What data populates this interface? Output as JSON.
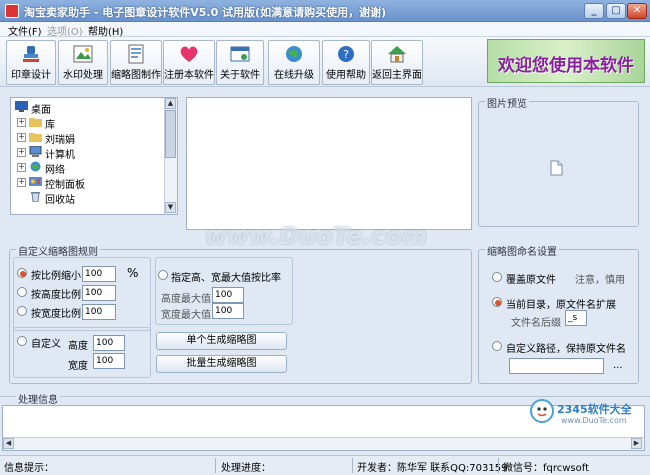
{
  "window": {
    "title": "淘宝卖家助手 - 电子图章设计软件V5.0 试用版(如满意请购买使用，谢谢)",
    "min_label": "_",
    "max_label": "□",
    "close_label": "✕"
  },
  "menu": {
    "file": "文件(F)",
    "options": "选项(O)",
    "help": "帮助(H)"
  },
  "toolbar": {
    "buttons": [
      {
        "label": "印章设计",
        "icon": "seal-icon"
      },
      {
        "label": "水印处理",
        "icon": "watermark-icon"
      },
      {
        "label": "缩略图制作",
        "icon": "thumbnail-icon"
      },
      {
        "label": "注册本软件",
        "icon": "register-heart-icon"
      },
      {
        "label": "关于软件",
        "icon": "about-icon"
      },
      {
        "label": "在线升级",
        "icon": "update-icon"
      },
      {
        "label": "使用帮助",
        "icon": "help-icon"
      },
      {
        "label": "返回主界面",
        "icon": "home-icon"
      }
    ],
    "banner_text": "欢迎您使用本软件"
  },
  "tree": {
    "items": [
      {
        "label": "桌面",
        "expander": ""
      },
      {
        "label": "库",
        "expander": "+"
      },
      {
        "label": "刘瑞娟",
        "expander": "+"
      },
      {
        "label": "计算机",
        "expander": "+"
      },
      {
        "label": "网络",
        "expander": "+"
      },
      {
        "label": "控制面板",
        "expander": "+"
      },
      {
        "label": "回收站",
        "expander": ""
      }
    ]
  },
  "preview": {
    "title": "图片预览"
  },
  "thumb_rules": {
    "title": "自定义缩略图规则",
    "by_ratio_label": "按比例缩小",
    "by_ratio_value": "100",
    "percent": "%",
    "by_height_label": "按高度比例",
    "by_height_value": "100",
    "by_width_label": "按宽度比例",
    "by_width_value": "100",
    "custom_label": "自定义",
    "custom_height_label": "高度",
    "custom_height_value": "100",
    "custom_width_label": "宽度",
    "custom_width_value": "100",
    "max_ratio_label": "指定高、宽最大值按比率",
    "max_height_label": "高度最大值",
    "max_height_value": "100",
    "max_width_label": "宽度最大值",
    "max_width_value": "100",
    "single_button": "单个生成缩略图",
    "batch_button": "批量生成缩略图"
  },
  "naming": {
    "title": "缩略图命名设置",
    "overwrite_label": "覆盖原文件",
    "note": "注意，慎用",
    "current_dir_label": "当前目录，原文件名扩展",
    "suffix_label": "文件名后缀",
    "suffix_value": "_s",
    "custom_path_label": "自定义路径，保持原文件名",
    "path_value": "",
    "browse_label": "..."
  },
  "log": {
    "title": "处理信息"
  },
  "status": {
    "info_label": "信息提示：",
    "progress_label": "处理进度：",
    "developer": "开发者：陈华军 联系QQ:703159",
    "wechat": "微信号：fqrcwsoft"
  },
  "watermarks": {
    "duote": "www.DuoTe.com",
    "site": "2345软件大全",
    "site_url": "www.DuoTe.com"
  },
  "colors": {
    "accent": "#d8552a",
    "banner_text": "#8a1fa0"
  }
}
